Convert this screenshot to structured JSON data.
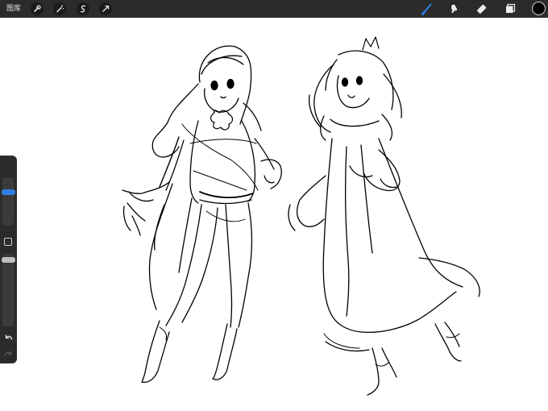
{
  "topbar": {
    "gallery_label": "图库",
    "left_buttons": [
      "wrench-icon",
      "magic-wand-icon",
      "selection-icon",
      "transform-arrow-icon"
    ],
    "tools": [
      "brush-icon",
      "smudge-icon",
      "eraser-icon",
      "layers-icon"
    ],
    "active_tool": "brush-icon",
    "current_color": "#000000"
  },
  "sidebar": {
    "brush_size_fraction": 0.72,
    "opacity_fraction": 0.95,
    "icons": [
      "undo-icon",
      "redo-icon",
      "modify-square-icon"
    ]
  },
  "colors": {
    "accent": "#2f7fe6",
    "toolbar": "#2b2b2b",
    "canvas": "#ffffff"
  }
}
